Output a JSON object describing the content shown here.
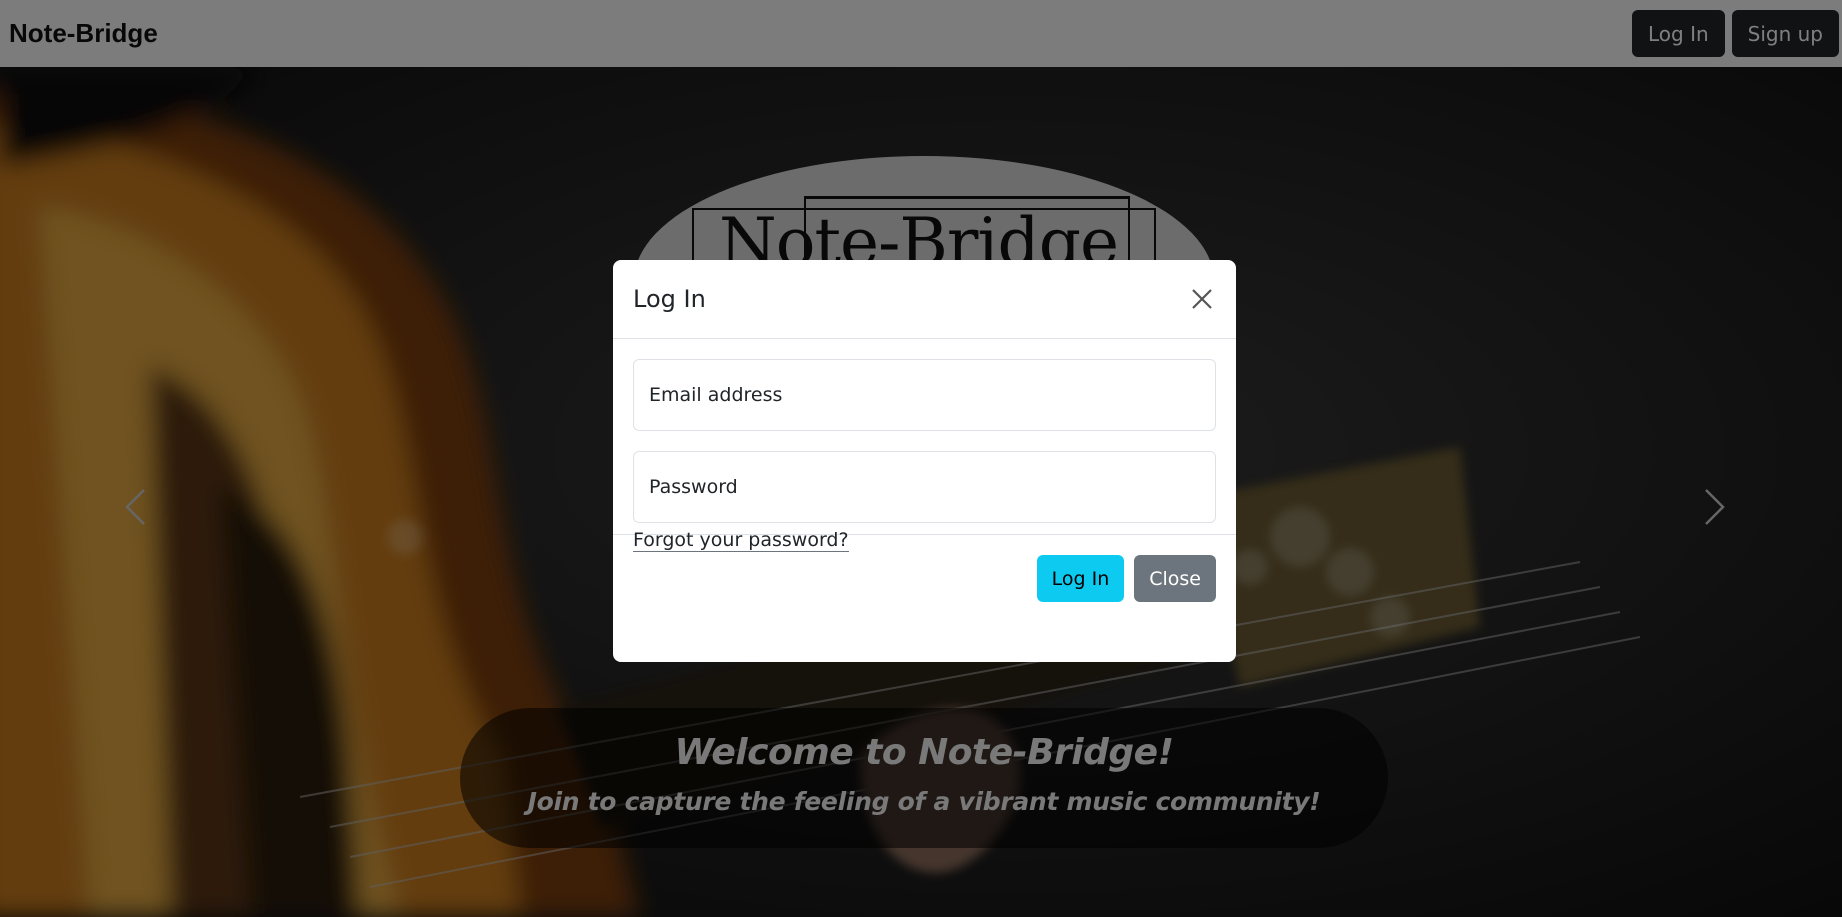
{
  "navbar": {
    "brand": "Note-Bridge",
    "login_label": "Log In",
    "signup_label": "Sign up"
  },
  "hero": {
    "logo_text": "Note-Bridge",
    "caption_title": "Welcome to Note-Bridge!",
    "caption_subtitle": "Join to capture the feeling of a vibrant music community!"
  },
  "modal": {
    "title": "Log In",
    "email_placeholder": "Email address",
    "email_value": "",
    "password_placeholder": "Password",
    "password_value": "",
    "forgot_link": "Forgot your password?",
    "login_button": "Log In",
    "close_button": "Close"
  },
  "icons": {
    "close": "close-icon",
    "prev": "chevron-left-icon",
    "next": "chevron-right-icon"
  },
  "colors": {
    "accent": "#0dcaf0",
    "secondary": "#6c757d",
    "dark": "#212529"
  }
}
